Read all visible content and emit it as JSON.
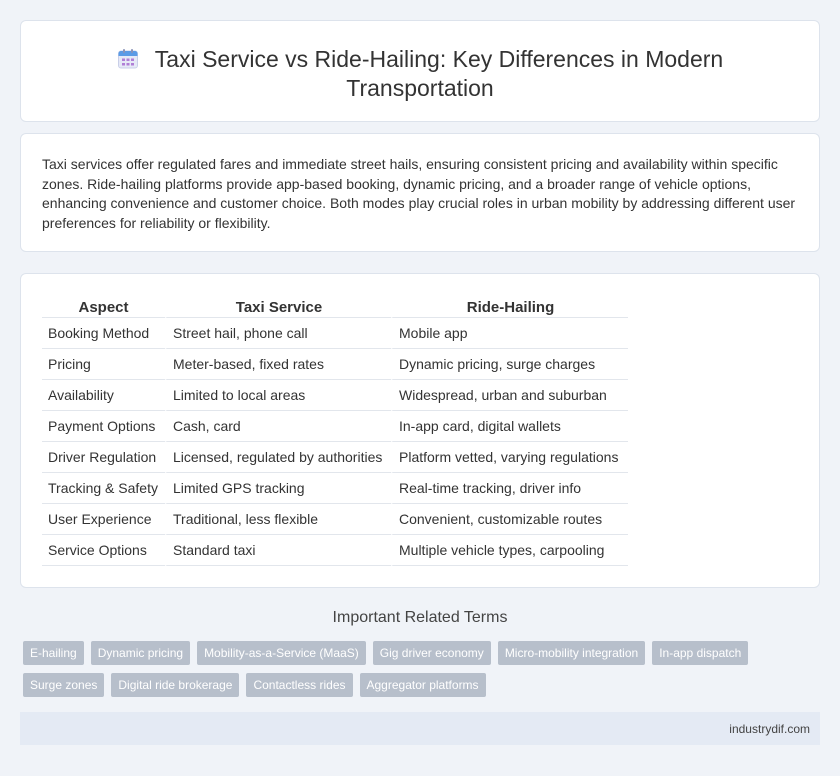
{
  "header": {
    "title_line1": "Taxi Service vs Ride-Hailing: Key Differences in Modern",
    "title_line2": "Transportation",
    "icon": "calendar-icon"
  },
  "intro": {
    "text": "Taxi services offer regulated fares and immediate street hails, ensuring consistent pricing and availability within specific zones. Ride-hailing platforms provide app-based booking, dynamic pricing, and a broader range of vehicle options, enhancing convenience and customer choice. Both modes play crucial roles in urban mobility by addressing different user preferences for reliability or flexibility."
  },
  "table": {
    "headers": [
      "Aspect",
      "Taxi Service",
      "Ride-Hailing"
    ],
    "rows": [
      [
        "Booking Method",
        "Street hail, phone call",
        "Mobile app"
      ],
      [
        "Pricing",
        "Meter-based, fixed rates",
        "Dynamic pricing, surge charges"
      ],
      [
        "Availability",
        "Limited to local areas",
        "Widespread, urban and suburban"
      ],
      [
        "Payment Options",
        "Cash, card",
        "In-app card, digital wallets"
      ],
      [
        "Driver Regulation",
        "Licensed, regulated by authorities",
        "Platform vetted, varying regulations"
      ],
      [
        "Tracking & Safety",
        "Limited GPS tracking",
        "Real-time tracking, driver info"
      ],
      [
        "User Experience",
        "Traditional, less flexible",
        "Convenient, customizable routes"
      ],
      [
        "Service Options",
        "Standard taxi",
        "Multiple vehicle types, carpooling"
      ]
    ]
  },
  "related": {
    "title": "Important Related Terms",
    "tags": [
      "E-hailing",
      "Dynamic pricing",
      "Mobility-as-a-Service (MaaS)",
      "Gig driver economy",
      "Micro-mobility integration",
      "In-app dispatch",
      "Surge zones",
      "Digital ride brokerage",
      "Contactless rides",
      "Aggregator platforms"
    ]
  },
  "footer": {
    "site": "industrydif.com"
  },
  "colors": {
    "background": "#f0f3f8",
    "tag": "#b7bfcb",
    "footer": "#e4eaf4"
  }
}
